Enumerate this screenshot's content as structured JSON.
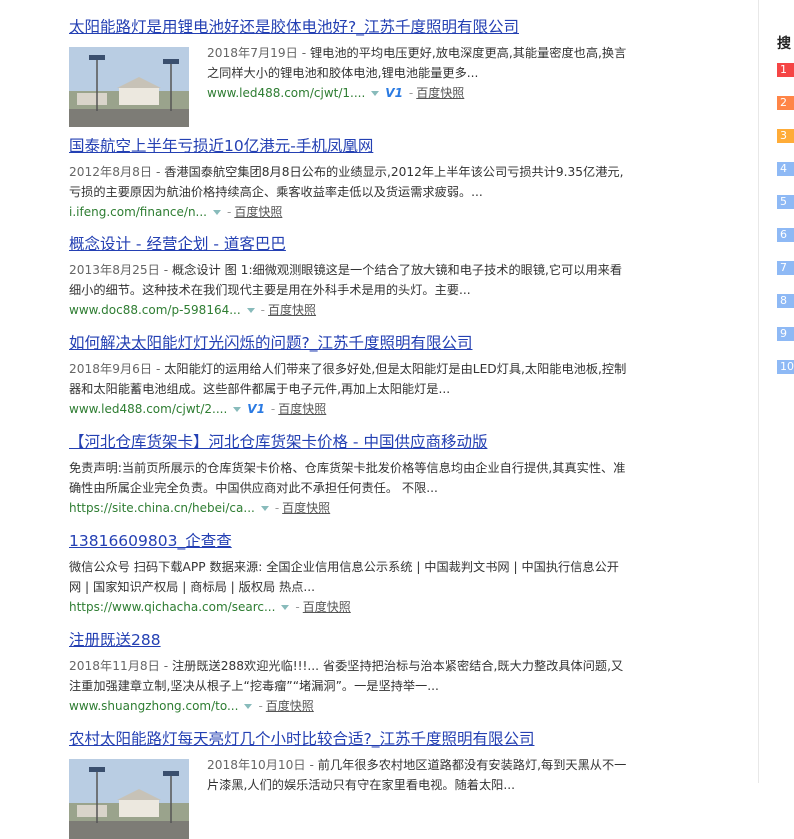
{
  "sidebar": {
    "title": "搜",
    "ranks": [
      {
        "n": "1",
        "color": "#f54545"
      },
      {
        "n": "2",
        "color": "#ff8547"
      },
      {
        "n": "3",
        "color": "#ffac38"
      },
      {
        "n": "4",
        "color": "#8eb9f5"
      },
      {
        "n": "5",
        "color": "#8eb9f5"
      },
      {
        "n": "6",
        "color": "#8eb9f5"
      },
      {
        "n": "7",
        "color": "#8eb9f5"
      },
      {
        "n": "8",
        "color": "#8eb9f5"
      },
      {
        "n": "9",
        "color": "#8eb9f5"
      },
      {
        "n": "10",
        "color": "#8eb9f5"
      }
    ]
  },
  "results": [
    {
      "title": "太阳能路灯是用锂电池好还是胶体电池好?_江苏千度照明有限公司",
      "thumb": true,
      "date": "2018年7月19日",
      "desc": "锂电池的平均电压更好,放电深度更高,其能量密度也高,换言之同样大小的锂电池和胶体电池,锂电池能量更多...",
      "source": "www.led488.com/cjwt/1....",
      "v1": "V1",
      "snapshot": "百度快照"
    },
    {
      "title": "国泰航空上半年亏损近10亿港元-手机凤凰网",
      "thumb": false,
      "date": "2012年8月8日",
      "desc": "香港国泰航空集团8月8日公布的业绩显示,2012年上半年该公司亏损共计9.35亿港元,亏损的主要原因为航油价格持续高企、乘客收益率走低以及货运需求疲弱。...",
      "source": "i.ifeng.com/finance/n...",
      "v1": "",
      "snapshot": "百度快照"
    },
    {
      "title": "概念设计 - 经营企划 - 道客巴巴",
      "thumb": false,
      "date": "2013年8月25日",
      "desc": "概念设计 图 1:细微观测眼镜这是一个结合了放大镜和电子技术的眼镜,它可以用来看细小的细节。这种技术在我们现代主要是用在外科手术是用的头灯。主要...",
      "source": "www.doc88.com/p-598164...",
      "v1": "",
      "snapshot": "百度快照"
    },
    {
      "title": "如何解决太阳能灯灯光闪烁的问题?_江苏千度照明有限公司",
      "thumb": false,
      "date": "2018年9月6日",
      "desc": "太阳能灯的运用给人们带来了很多好处,但是太阳能灯是由LED灯具,太阳能电池板,控制器和太阳能蓄电池组成。这些部件都属于电子元件,再加上太阳能灯是...",
      "source": "www.led488.com/cjwt/2....",
      "v1": "V1",
      "snapshot": "百度快照"
    },
    {
      "title": "【河北仓库货架卡】河北仓库货架卡价格 - 中国供应商移动版",
      "thumb": false,
      "date": "",
      "desc": "免责声明:当前页所展示的仓库货架卡价格、仓库货架卡批发价格等信息均由企业自行提供,其真实性、准确性由所属企业完全负责。中国供应商对此不承担任何责任。 不限...",
      "source": "https://site.china.cn/hebei/ca...",
      "v1": "",
      "snapshot": "百度快照"
    },
    {
      "title": "13816609803_企查查",
      "thumb": false,
      "date": "",
      "desc": "微信公众号 扫码下载APP 数据来源: 全国企业信用信息公示系统 | 中国裁判文书网 | 中国执行信息公开网 | 国家知识产权局 | 商标局 | 版权局 热点...",
      "source": "https://www.qichacha.com/searc...",
      "v1": "",
      "snapshot": "百度快照"
    },
    {
      "title": "注册既送288",
      "thumb": false,
      "date": "2018年11月8日",
      "desc": "注册既送288欢迎光临!!!... 省委坚持把治标与治本紧密结合,既大力整改具体问题,又注重加强建章立制,坚决从根子上“挖毒瘤”“堵漏洞”。一是坚持举一...",
      "source": "www.shuangzhong.com/to...",
      "v1": "",
      "snapshot": "百度快照"
    },
    {
      "title": "农村太阳能路灯每天亮灯几个小时比较合适?_江苏千度照明有限公司",
      "thumb": true,
      "date": "2018年10月10日",
      "desc": "前几年很多农村地区道路都没有安装路灯,每到天黑从不一片漆黑,人们的娱乐活动只有守在家里看电视。随着太阳...",
      "source": "",
      "v1": "",
      "snapshot": ""
    }
  ]
}
